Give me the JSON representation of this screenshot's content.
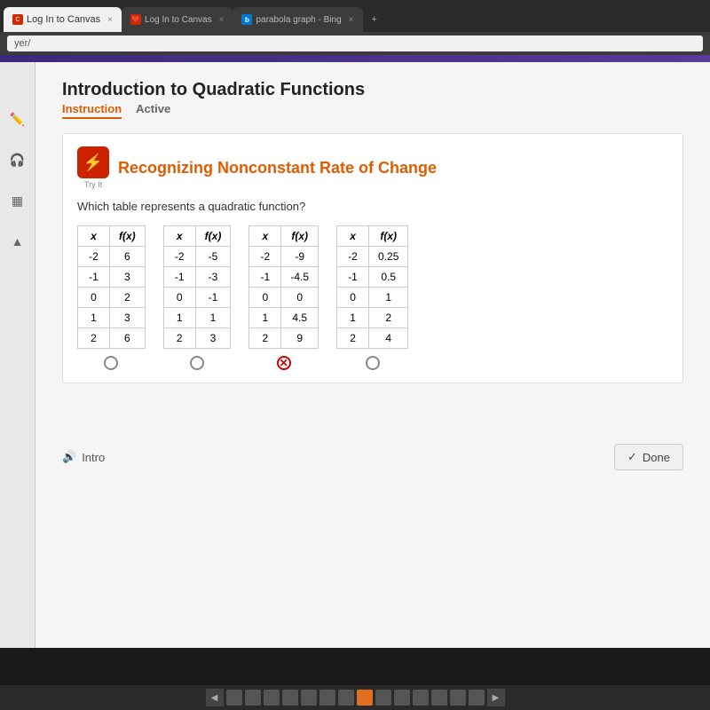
{
  "browser": {
    "tabs": [
      {
        "label": "Log In to Canvas",
        "active": true,
        "icon": "canvas",
        "closeBtn": "×"
      },
      {
        "label": "Log In to Canvas",
        "active": false,
        "icon": "canvas",
        "closeBtn": "×"
      },
      {
        "label": "parabola graph - Bing",
        "active": false,
        "icon": "bing",
        "closeBtn": "×"
      },
      {
        "label": "+",
        "active": false,
        "icon": "plus",
        "closeBtn": ""
      }
    ],
    "addressBar": "yer/"
  },
  "page": {
    "title": "Introduction to Quadratic Functions",
    "tabs": [
      {
        "label": "Instruction",
        "active": true
      },
      {
        "label": "Active",
        "active": false
      }
    ]
  },
  "tryIt": {
    "iconLabel": "Try It",
    "title": "Recognizing Nonconstant Rate of Change",
    "question": "Which table represents a quadratic function?"
  },
  "tables": [
    {
      "id": "table1",
      "headers": [
        "x",
        "f(x)"
      ],
      "rows": [
        [
          "-2",
          "6"
        ],
        [
          "-1",
          "3"
        ],
        [
          "0",
          "2"
        ],
        [
          "1",
          "3"
        ],
        [
          "2",
          "6"
        ]
      ],
      "selected": false,
      "selectedWrong": false
    },
    {
      "id": "table2",
      "headers": [
        "x",
        "f(x)"
      ],
      "rows": [
        [
          "-2",
          "-5"
        ],
        [
          "-1",
          "-3"
        ],
        [
          "0",
          "-1"
        ],
        [
          "1",
          "1"
        ],
        [
          "2",
          "3"
        ]
      ],
      "selected": false,
      "selectedWrong": false
    },
    {
      "id": "table3",
      "headers": [
        "x",
        "f(x)"
      ],
      "rows": [
        [
          "-2",
          "-9"
        ],
        [
          "-1",
          "-4.5"
        ],
        [
          "0",
          "0"
        ],
        [
          "1",
          "4.5"
        ],
        [
          "2",
          "9"
        ]
      ],
      "selected": true,
      "selectedWrong": true
    },
    {
      "id": "table4",
      "headers": [
        "x",
        "f(x)"
      ],
      "rows": [
        [
          "-2",
          "0.25"
        ],
        [
          "-1",
          "0.5"
        ],
        [
          "0",
          "1"
        ],
        [
          "1",
          "2"
        ],
        [
          "2",
          "4"
        ]
      ],
      "selected": false,
      "selectedWrong": false
    }
  ],
  "footer": {
    "introLabel": "Intro",
    "doneLabel": "Done"
  },
  "sidebar": {
    "icons": [
      "✏️",
      "🎧",
      "📋",
      "⬆"
    ]
  }
}
